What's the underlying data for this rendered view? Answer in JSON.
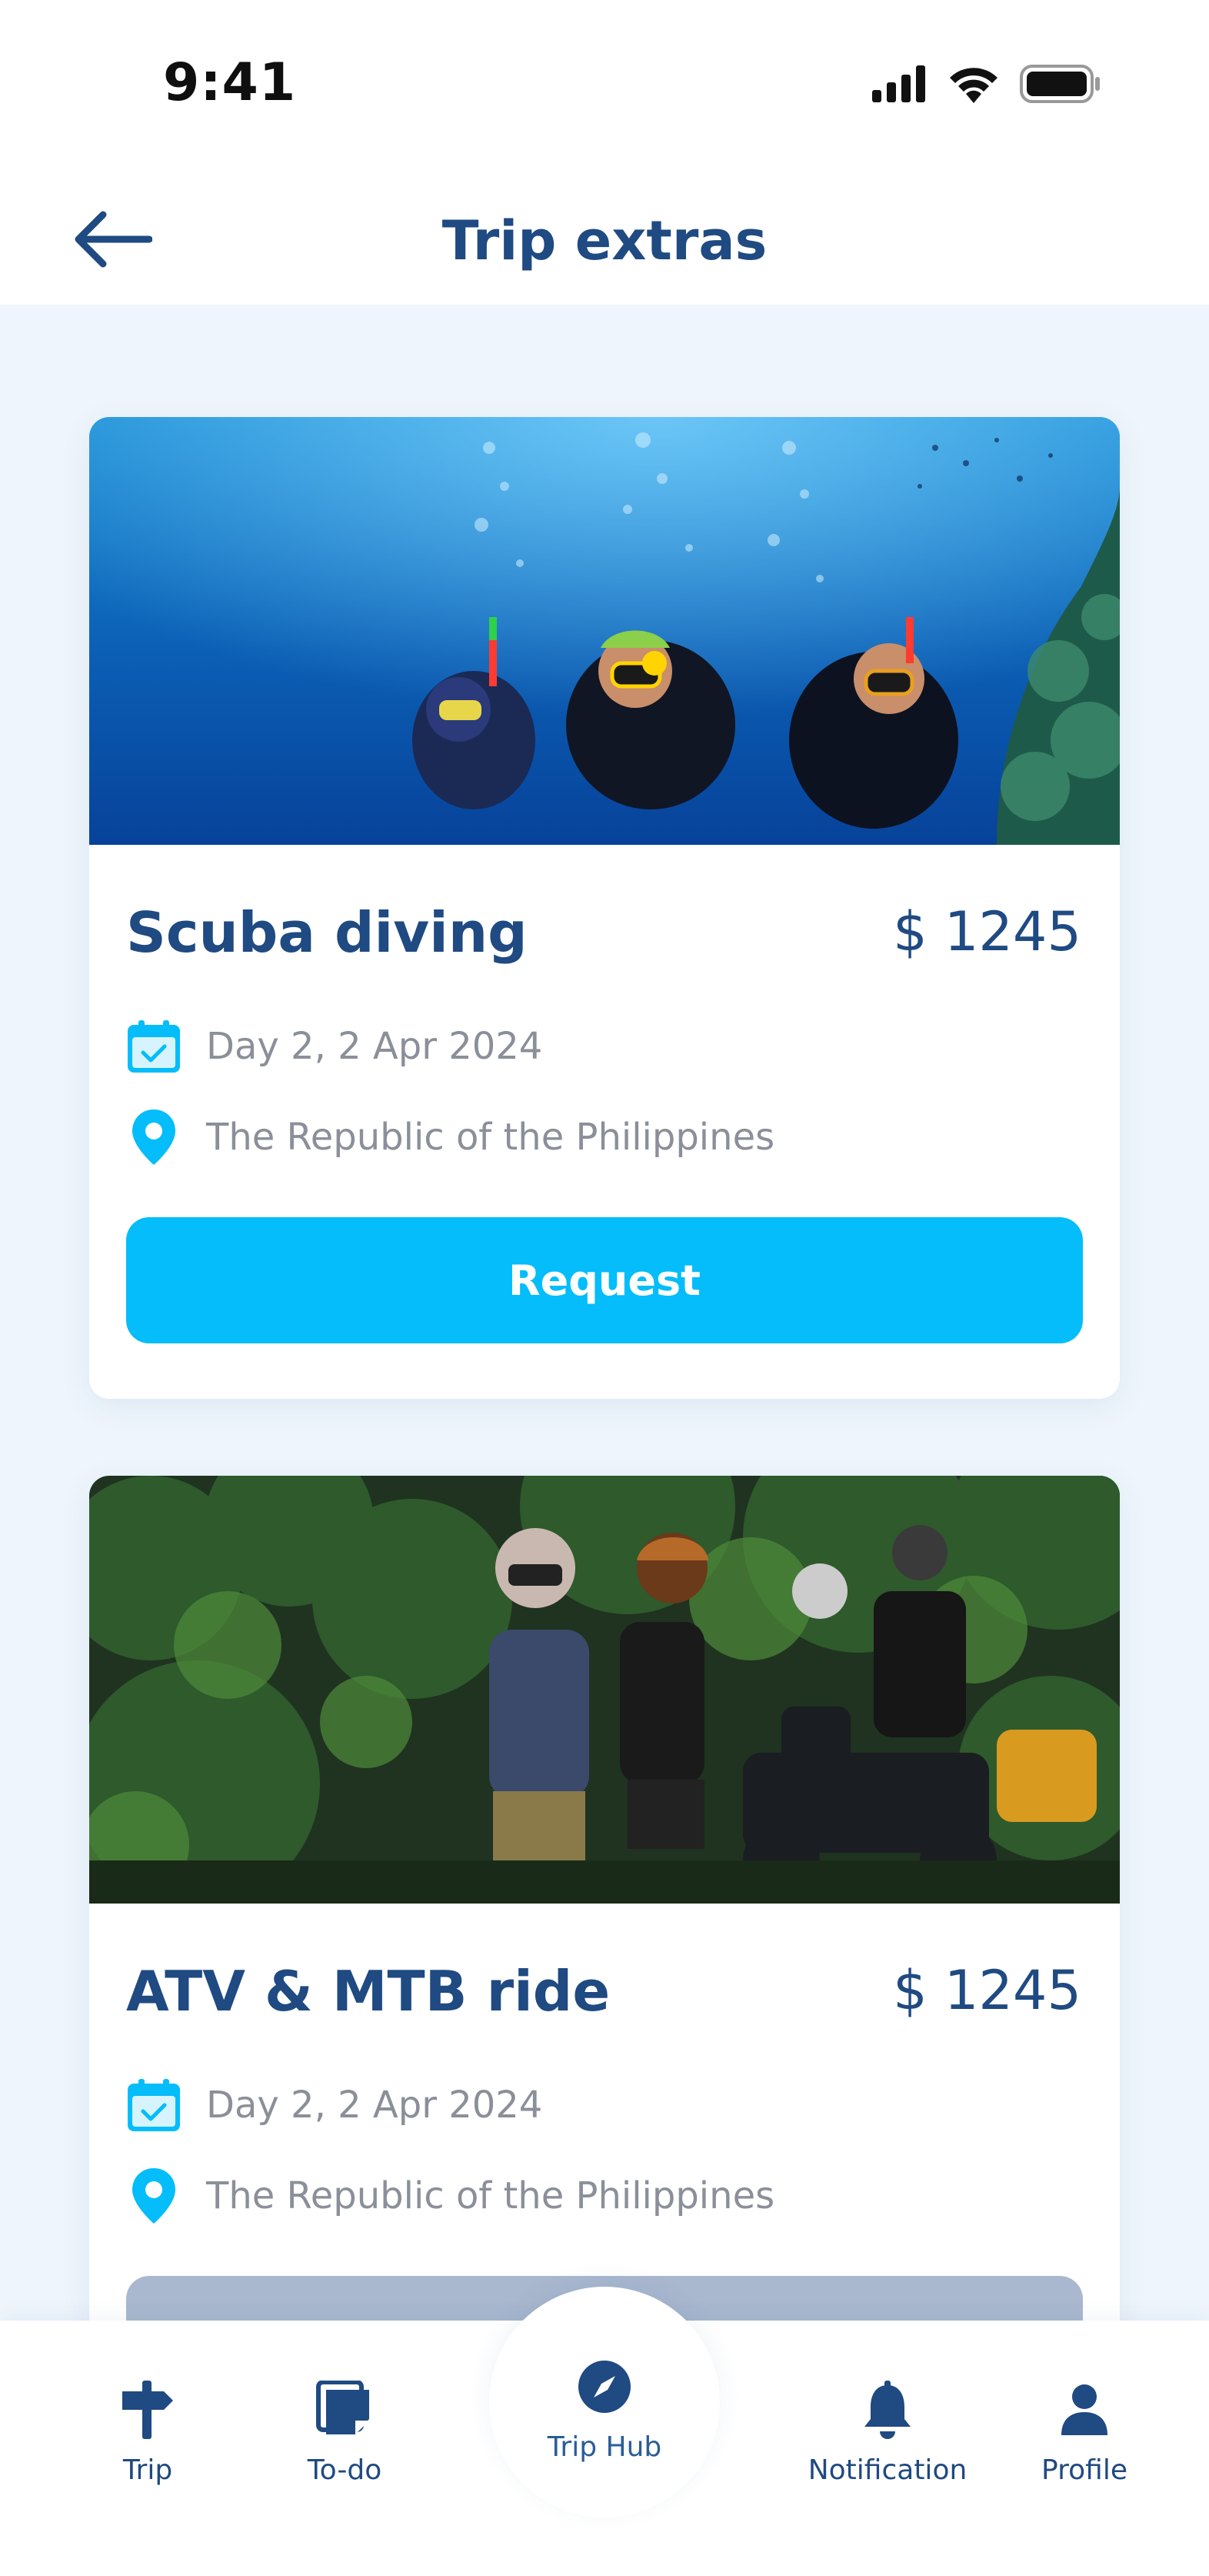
{
  "status": {
    "time": "9:41"
  },
  "header": {
    "title": "Trip extras"
  },
  "cards": [
    {
      "title": "Scuba diving",
      "price": "$ 1245",
      "date": "Day 2, 2 Apr 2024",
      "location": "The Republic of the Philippines",
      "button": "Request",
      "image": "scuba-divers-photo"
    },
    {
      "title": "ATV & MTB ride",
      "price": "$ 1245",
      "date": "Day 2, 2 Apr 2024",
      "location": "The Republic of the Philippines",
      "button": "",
      "image": "atv-riders-photo"
    }
  ],
  "nav": {
    "items": [
      {
        "label": "Trip",
        "icon": "signpost-icon"
      },
      {
        "label": "To-do",
        "icon": "notes-icon"
      },
      {
        "label": "Trip Hub",
        "icon": "compass-icon"
      },
      {
        "label": "Notification",
        "icon": "bell-icon"
      },
      {
        "label": "Profile",
        "icon": "person-icon"
      }
    ]
  },
  "colors": {
    "primary": "#1f4a82",
    "accent": "#04bdfa",
    "muted": "#8a8f99",
    "background": "#eef5fc",
    "disabled": "#a9b8cf"
  }
}
